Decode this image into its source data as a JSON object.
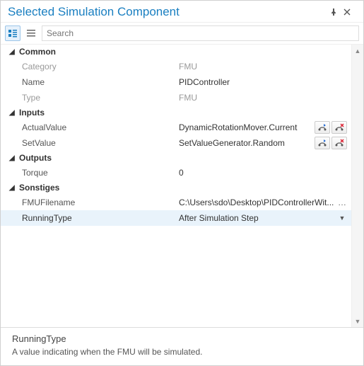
{
  "window": {
    "title": "Selected Simulation Component"
  },
  "toolbar": {
    "search_placeholder": "Search"
  },
  "groups": {
    "common": {
      "label": "Common",
      "category": {
        "label": "Category",
        "value": "FMU"
      },
      "name": {
        "label": "Name",
        "value": "PIDController"
      },
      "type": {
        "label": "Type",
        "value": "FMU"
      }
    },
    "inputs": {
      "label": "Inputs",
      "actualValue": {
        "label": "ActualValue",
        "value": "DynamicRotationMover.Current"
      },
      "setValue": {
        "label": "SetValue",
        "value": "SetValueGenerator.Random"
      }
    },
    "outputs": {
      "label": "Outputs",
      "torque": {
        "label": "Torque",
        "value": "0"
      }
    },
    "sonstiges": {
      "label": "Sonstiges",
      "fmuFilename": {
        "label": "FMUFilename",
        "value": "C:\\Users\\sdo\\Desktop\\PIDControllerWit..."
      },
      "runningType": {
        "label": "RunningType",
        "value": "After Simulation Step"
      }
    }
  },
  "description": {
    "title": "RunningType",
    "text": "A value indicating when the FMU will be simulated."
  }
}
